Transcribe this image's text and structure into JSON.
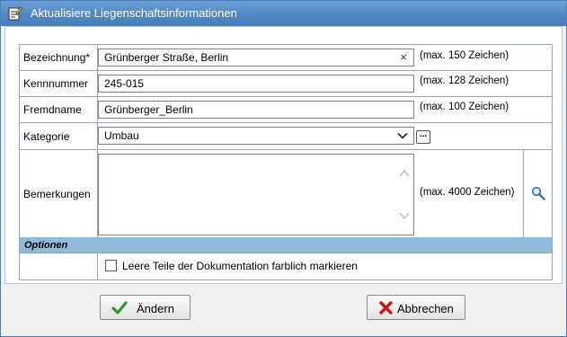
{
  "window": {
    "title": "Aktualisiere Liegenschaftsinformationen",
    "icon": "edit-form-icon"
  },
  "form": {
    "bezeichnung": {
      "label": "Bezeichnung*",
      "value": "Grünberger Straße, Berlin",
      "clear": "×",
      "hint": "(max. 150 Zeichen)"
    },
    "kennnummer": {
      "label": "Kennnummer",
      "value": "245-015",
      "hint": "(max. 128 Zeichen)"
    },
    "fremdname": {
      "label": "Fremdname",
      "value": "Grünberger_Berlin",
      "hint": "(max. 100 Zeichen)"
    },
    "kategorie": {
      "label": "Kategorie",
      "value": "Umbau",
      "browse": "..."
    },
    "bemerkungen": {
      "label": "Bemerkungen",
      "value": "",
      "hint": "(max. 4000 Zeichen)",
      "icon": "magnifier-icon"
    }
  },
  "options": {
    "header": "Optionen",
    "checkbox_label": "Leere Teile der Dokumentation farblich markieren",
    "checked": false
  },
  "buttons": {
    "change": {
      "label": "Ändern",
      "icon": "checkmark-icon",
      "color": "#2e9a2e"
    },
    "cancel": {
      "label": "Abbrechen",
      "icon": "x-icon",
      "color": "#c81818"
    }
  }
}
